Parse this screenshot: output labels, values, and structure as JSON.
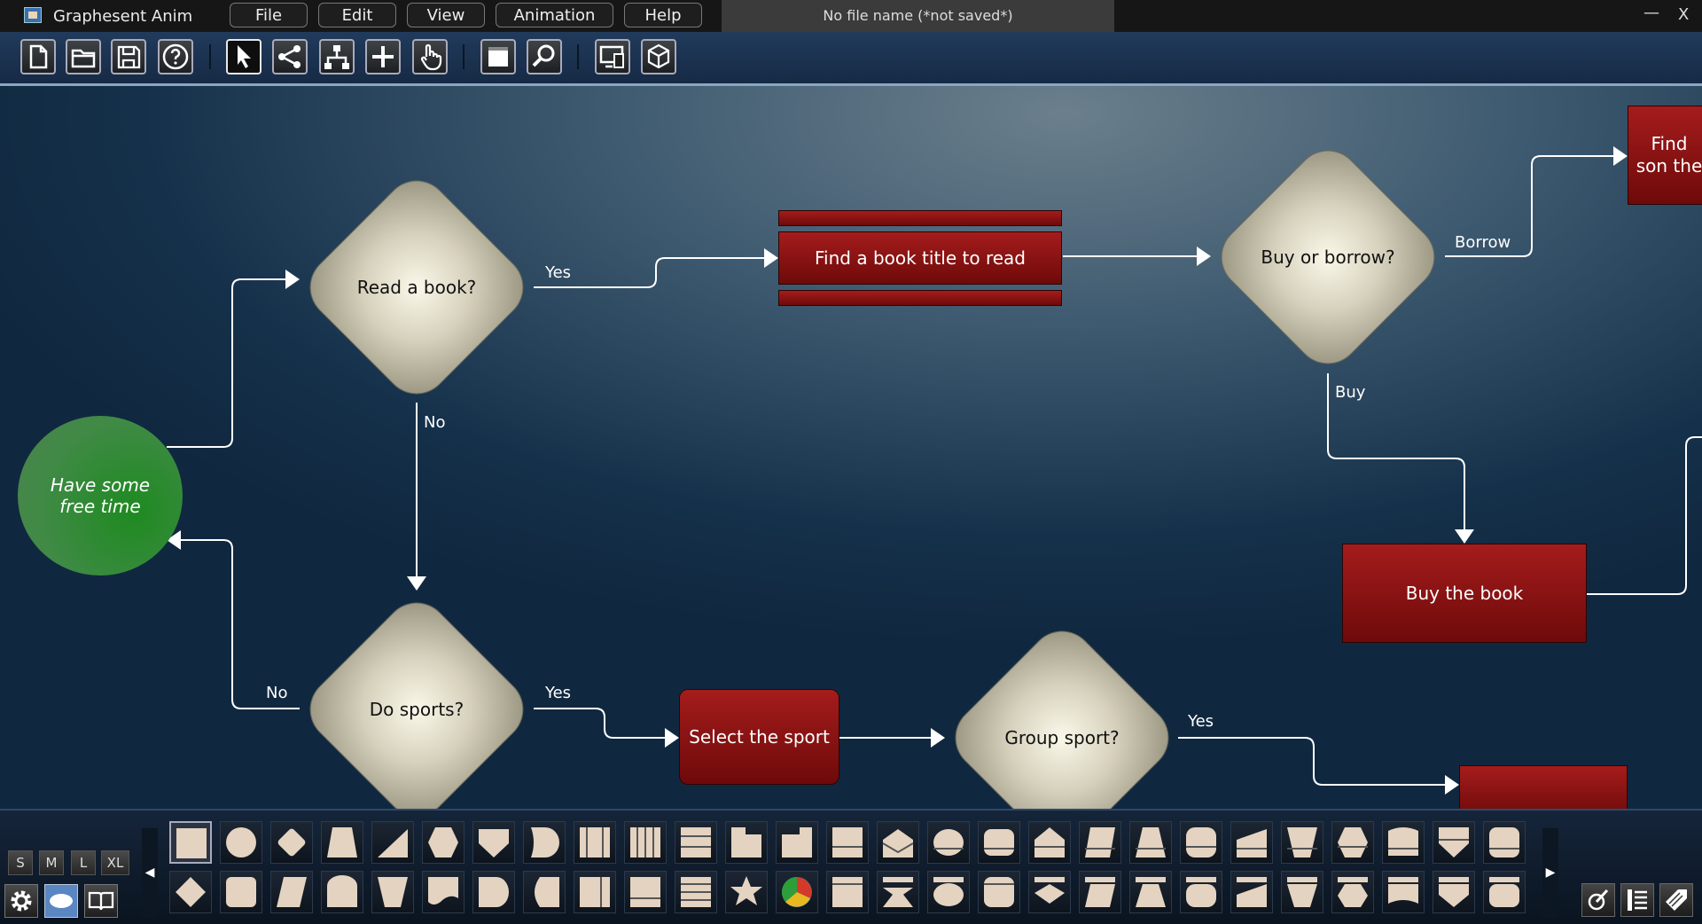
{
  "app": {
    "name": "Graphesent Anim",
    "document_title": "No file name (*not saved*)"
  },
  "menu": [
    "File",
    "Edit",
    "View",
    "Animation",
    "Help"
  ],
  "window_controls": {
    "minimize": "—",
    "close": "X"
  },
  "toolbar_icons": [
    "new-file-icon",
    "open-folder-icon",
    "save-icon",
    "help-icon",
    "select-arrow-icon",
    "share-icon",
    "hierarchy-icon",
    "add-icon",
    "hand-pointer-icon",
    "frame-icon",
    "zoom-icon",
    "device-preview-icon",
    "cube-3d-icon"
  ],
  "nodes": {
    "start": "Have some free time",
    "read_book": "Read a book?",
    "find_title": "Find a book title to read",
    "buy_or_borrow": "Buy or borrow?",
    "find_some": "Find son the",
    "buy_book": "Buy the book",
    "do_sports": "Do sports?",
    "select_sport": "Select the sport",
    "group_sport": "Group sport?"
  },
  "edge_labels": {
    "read_yes": "Yes",
    "read_no": "No",
    "borrow": "Borrow",
    "buy": "Buy",
    "sports_no": "No",
    "sports_yes": "Yes",
    "group_yes": "Yes"
  },
  "palette": {
    "sizes": [
      "S",
      "M",
      "L",
      "XL"
    ],
    "left_tools": [
      "gear-icon",
      "ellipse-shape-icon",
      "book-icon"
    ],
    "right_tools": [
      "brush-icon",
      "list-icon",
      "tag-icon"
    ],
    "nav_left": "◀",
    "nav_right": "▶"
  },
  "colors": {
    "node_red": "#8d1414",
    "node_green": "#2f8a35",
    "diamond_fill": "#d6d1bc",
    "accent_blue": "#5a86c2"
  }
}
